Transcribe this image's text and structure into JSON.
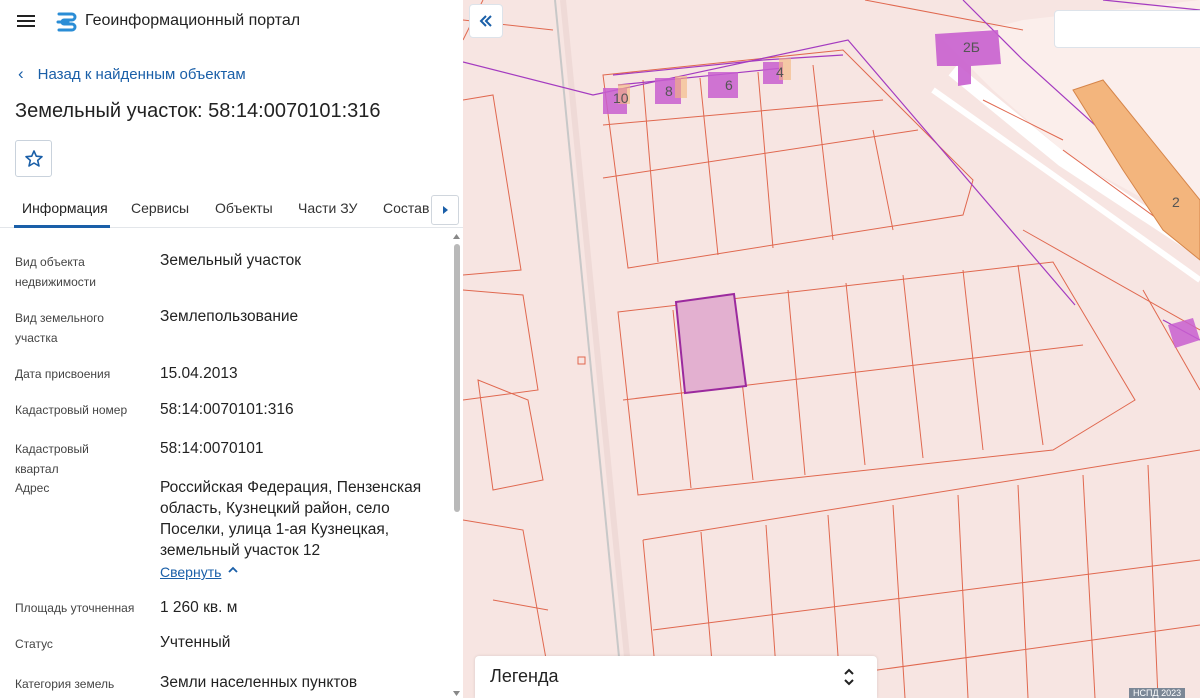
{
  "header": {
    "menu_icon": "hamburger-menu-icon",
    "logo_icon": "portal-logo-icon",
    "title": "Геоинформационный портал"
  },
  "panel": {
    "back_label": "Назад к найденным объектам",
    "object_title": "Земельный участок: 58:14:0070101:316",
    "tabs": [
      {
        "label": "Информация",
        "active": true
      },
      {
        "label": "Сервисы",
        "active": false
      },
      {
        "label": "Объекты",
        "active": false
      },
      {
        "label": "Части ЗУ",
        "active": false
      },
      {
        "label": "Состав",
        "active": false
      }
    ],
    "properties": [
      {
        "label": "Вид объекта недвижимости",
        "value": "Земельный участок"
      },
      {
        "label": "Вид земельного участка",
        "value": "Землепользование"
      },
      {
        "label": "Дата присвоения",
        "value": "15.04.2013"
      },
      {
        "label": "Кадастровый номер",
        "value": "58:14:0070101:316"
      },
      {
        "label": "Кадастровый квартал",
        "value": "58:14:0070101"
      },
      {
        "label": "Адрес",
        "value": "Российская Федерация, Пензенская область, Кузнецкий район, село Поселки, улица 1-ая Кузнецкая, земельный участок 12"
      },
      {
        "label": "Площадь уточненная",
        "value": "1 260 кв. м"
      },
      {
        "label": "Статус",
        "value": "Учтенный"
      },
      {
        "label": "Категория земель",
        "value": "Земли населенных пунктов"
      }
    ],
    "collapse_label": "Свернуть"
  },
  "map": {
    "building_labels": [
      "2Б",
      "10",
      "8",
      "6",
      "4",
      "2"
    ],
    "legend_label": "Легенда",
    "attribution": "НСПД 2023",
    "colors": {
      "background": "#f7e5e2",
      "parcel_line": "#e0684f",
      "boundary_line": "#a43bc0",
      "selected_fill": "#e3b0d0",
      "selected_stroke": "#9b2a9e",
      "building_fill": "#c85fcf",
      "building_orange": "#f3b57d",
      "accent": "#1a5fa8"
    }
  }
}
